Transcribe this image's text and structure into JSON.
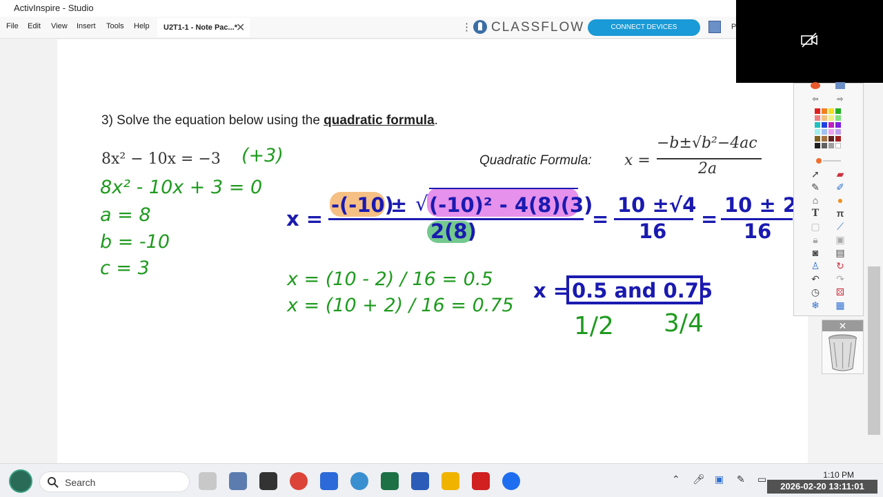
{
  "window": {
    "title": "ActivInspire - Studio"
  },
  "menu": [
    "File",
    "Edit",
    "View",
    "Insert",
    "Tools",
    "Help"
  ],
  "doc_tab": {
    "label": "U2T1-1 - Note Pac...*"
  },
  "classflow": {
    "logo_text": "CLASSFLOW",
    "connect_label": "CONNECT DEVICES",
    "p_label": "P"
  },
  "question": {
    "prefix": "3) Solve the equation below using the ",
    "emphasis": "quadratic formula",
    "suffix": "."
  },
  "equation": {
    "lhs": "8x² − 10x = −3",
    "note": "(+3)"
  },
  "quadratic_formula": {
    "label": "Quadratic Formula:",
    "x_eq": "x =",
    "numerator": "−b±√b²−4ac",
    "denominator": "2a"
  },
  "work_left": {
    "line1": "8x² - 10x + 3 = 0",
    "a": "a = 8",
    "b": "b = -10",
    "c": "c = 3"
  },
  "substitution": {
    "x_label": "x =",
    "neg_b": "-(-10)",
    "pm": "±",
    "root_term": "(-10)² - 4(8)(3)",
    "denominator": "2(8)",
    "eq1": "=",
    "step2_num": "10 ±√4",
    "step2_den": "16",
    "eq2": "=",
    "step3_num": "10 ± 2",
    "step3_den": "16"
  },
  "solutions": {
    "line1": "x = (10 - 2) / 16 = 0.5",
    "line2": "x = (10 + 2) / 16 = 0.75"
  },
  "answer": {
    "label": "x =",
    "value": "0.5 and 0.75",
    "frac1": "1/2",
    "frac2": "3/4"
  },
  "colors": {
    "green_ink": "#1f9a1f",
    "blue_ink": "#1a1ab0",
    "highlight_orange": "#f5b56e",
    "highlight_pink": "#e27ee8",
    "highlight_green": "#5cbf7a"
  },
  "taskbar": {
    "search_placeholder": "Search",
    "time": "1:10 PM"
  },
  "timestamp": "2026-02-20 13:11:01"
}
